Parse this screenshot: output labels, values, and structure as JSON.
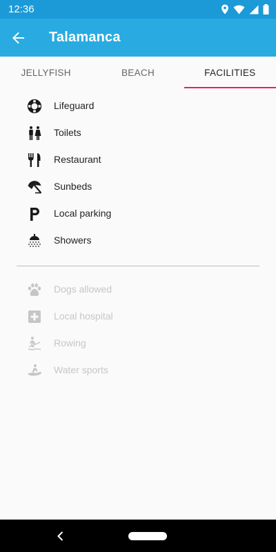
{
  "status_bar": {
    "time": "12:36"
  },
  "app_bar": {
    "title": "Talamanca",
    "accent_color": "#29abe2"
  },
  "tabs": [
    {
      "label": "JELLYFISH",
      "active": false
    },
    {
      "label": "BEACH",
      "active": false
    },
    {
      "label": "FACILITIES",
      "active": true
    }
  ],
  "tab_indicator_color": "#e91e63",
  "available_facilities": [
    {
      "label": "Lifeguard",
      "icon": "lifebuoy-icon"
    },
    {
      "label": "Toilets",
      "icon": "toilets-icon"
    },
    {
      "label": "Restaurant",
      "icon": "restaurant-icon"
    },
    {
      "label": "Sunbeds",
      "icon": "beach-umbrella-icon"
    },
    {
      "label": "Local parking",
      "icon": "parking-icon"
    },
    {
      "label": "Showers",
      "icon": "shower-icon"
    }
  ],
  "unavailable_facilities": [
    {
      "label": "Dogs allowed",
      "icon": "paw-icon"
    },
    {
      "label": "Local hospital",
      "icon": "hospital-icon"
    },
    {
      "label": "Rowing",
      "icon": "rowing-icon"
    },
    {
      "label": "Water sports",
      "icon": "jet-ski-icon"
    }
  ],
  "colors": {
    "available_icon": "#1a1a1a",
    "unavailable": "#c6c6c6"
  }
}
